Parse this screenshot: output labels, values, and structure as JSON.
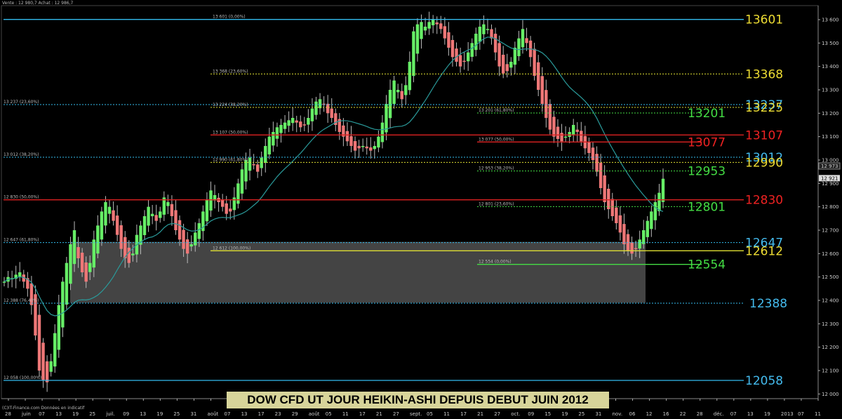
{
  "header": {
    "quote": "Vente : 12 980,7 Achat : 12 986,7"
  },
  "title": "DOW CFD UT JOUR HEIKIN-ASHI DEPUIS DEBUT JUIN 2012",
  "credit": "(C)IT-Finance.com Données en indicatif",
  "colors": {
    "background": "#000000",
    "up": "#66ee66",
    "down": "#ee7777",
    "ma": "#2a9a9a",
    "box": "#4b4b4b",
    "title_bg": "#d7d49a"
  },
  "chart_data": {
    "type": "candlestick",
    "ylim": [
      11980,
      13660
    ],
    "y_ticks": [
      12000,
      12100,
      12200,
      12300,
      12400,
      12500,
      12600,
      12700,
      12800,
      12900,
      13000,
      13100,
      13200,
      13300,
      13400,
      13500,
      13600
    ],
    "y_tick_labels": [
      "12 000",
      "12 100",
      "12 200",
      "12 300",
      "12 400",
      "12 500",
      "12 600",
      "12 700",
      "12 800",
      "12 900",
      "13 000",
      "13 100",
      "13 200",
      "13 300",
      "13 400",
      "13 500",
      "13 600"
    ],
    "last_price_label": "12 921",
    "last_price_tag": "12 973",
    "x_labels": [
      "28",
      "juin",
      "07",
      "13",
      "19",
      "25",
      "juil.",
      "09",
      "13",
      "19",
      "25",
      "31",
      "août",
      "07",
      "13",
      "17",
      "23",
      "29",
      "août",
      "05",
      "11",
      "17",
      "21",
      "27",
      "sept.",
      "05",
      "11",
      "17",
      "21",
      "27",
      "oct.",
      "09",
      "15",
      "19",
      "25",
      "31",
      "nov.",
      "06",
      "12",
      "16",
      "22",
      "28",
      "déc.",
      "07",
      "13",
      "19",
      "2013",
      "07",
      "11"
    ],
    "levels": [
      {
        "value": 13601,
        "label": "13601",
        "color": "#33bbee",
        "big_color": "#eedd33",
        "style": "solid",
        "small": "13 601 (0,00%)",
        "x_end": 1060
      },
      {
        "value": 13368,
        "label": "13368",
        "color": "#dddd33",
        "big_color": "#eedd33",
        "style": "dotted",
        "small": "13 368 (23,60%)",
        "x_end": 1060
      },
      {
        "value": 13237,
        "label": "13237",
        "color": "#33bbee",
        "big_color": "#44bbee",
        "style": "dotted",
        "small": "13 237 (23,60%)",
        "x_end": 1060
      },
      {
        "value": 13225,
        "label": "13225",
        "color": "#dddd33",
        "big_color": "#eedd33",
        "style": "dotted",
        "small": "13 224 (38,20%)",
        "x_end": 1060
      },
      {
        "value": 13201,
        "label": "13201",
        "color": "#44dd44",
        "big_color": "#44dd44",
        "style": "dotted",
        "small": "13 201 (61,80%)",
        "x_end": 1000
      },
      {
        "value": 13107,
        "label": "13107",
        "color": "#dd2222",
        "big_color": "#ee2222",
        "style": "solid",
        "small": "13 107 (50,00%)",
        "x_end": 1060
      },
      {
        "value": 13077,
        "label": "13077",
        "color": "#dd2222",
        "big_color": "#ee2222",
        "style": "solid",
        "small": "13 077 (50,00%)",
        "x_end": 1000
      },
      {
        "value": 13012,
        "label": "13012",
        "color": "#33bbee",
        "big_color": "#44bbee",
        "style": "dotted",
        "small": "13 012 (38,20%)",
        "x_end": 1060
      },
      {
        "value": 12990,
        "label": "12990",
        "color": "#dddd33",
        "big_color": "#eedd33",
        "style": "dotted",
        "small": "12 990 (61,80%)",
        "x_end": 1060
      },
      {
        "value": 12953,
        "label": "12953",
        "color": "#44dd44",
        "big_color": "#44dd44",
        "style": "dotted",
        "small": "12 953 (38,20%)",
        "x_end": 1000
      },
      {
        "value": 12830,
        "label": "12830",
        "color": "#dd2222",
        "big_color": "#ee2222",
        "style": "solid",
        "small": "12 830 (50,00%)",
        "x_end": 1060
      },
      {
        "value": 12801,
        "label": "12801",
        "color": "#44dd44",
        "big_color": "#44dd44",
        "style": "dotted",
        "small": "12 801 (23,60%)",
        "x_end": 1000
      },
      {
        "value": 12647,
        "label": "12647",
        "color": "#33bbee",
        "big_color": "#44bbee",
        "style": "dotted",
        "small": "12 647 (61,80%)",
        "x_end": 1060
      },
      {
        "value": 12612,
        "label": "12612",
        "color": "#dddd33",
        "big_color": "#eedd33",
        "style": "solid",
        "small": "12 612 (100,00%)",
        "x_end": 1060
      },
      {
        "value": 12554,
        "label": "12554",
        "color": "#44dd44",
        "big_color": "#44dd44",
        "style": "solid",
        "small": "12 554 (0,00%)",
        "x_end": 1000
      },
      {
        "value": 12388,
        "label": "12388",
        "color": "#33bbee",
        "big_color": "#44bbee",
        "style": "dotted",
        "small": "12 388 (76,40%)",
        "x_end": 1060
      },
      {
        "value": 12058,
        "label": "12058",
        "color": "#33bbee",
        "big_color": "#44bbee",
        "style": "solid",
        "small": "12 058 (100,00%)",
        "x_end": 1060
      }
    ],
    "range_box": {
      "top": 12650,
      "bottom": 12390
    },
    "closes": [
      12480,
      12500,
      12495,
      12510,
      12520,
      12480,
      12450,
      12380,
      12250,
      12100,
      12060,
      12050,
      12140,
      12260,
      12380,
      12480,
      12560,
      12640,
      12700,
      12580,
      12520,
      12480,
      12560,
      12660,
      12720,
      12780,
      12820,
      12800,
      12740,
      12680,
      12620,
      12580,
      12560,
      12600,
      12680,
      12720,
      12760,
      12800,
      12770,
      12740,
      12780,
      12840,
      12820,
      12760,
      12700,
      12660,
      12620,
      12600,
      12640,
      12690,
      12730,
      12780,
      12830,
      12870,
      12850,
      12820,
      12800,
      12770,
      12780,
      12840,
      12900,
      12960,
      13000,
      13010,
      12980,
      12950,
      13010,
      13060,
      13100,
      13120,
      13140,
      13150,
      13160,
      13170,
      13180,
      13160,
      13140,
      13150,
      13180,
      13220,
      13250,
      13260,
      13240,
      13200,
      13180,
      13150,
      13120,
      13100,
      13080,
      13060,
      13040,
      13050,
      13060,
      13050,
      13040,
      13060,
      13100,
      13160,
      13240,
      13300,
      13340,
      13300,
      13260,
      13320,
      13420,
      13550,
      13580,
      13590,
      13570,
      13590,
      13600,
      13580,
      13560,
      13520,
      13480,
      13440,
      13420,
      13400,
      13420,
      13460,
      13500,
      13540,
      13570,
      13580,
      13560,
      13520,
      13460,
      13400,
      13370,
      13380,
      13420,
      13480,
      13520,
      13560,
      13500,
      13440,
      13360,
      13300,
      13240,
      13180,
      13130,
      13100,
      13090,
      13080,
      13100,
      13120,
      13150,
      13120,
      13080,
      13050,
      13030,
      13000,
      12950,
      12880,
      12820,
      12790,
      12760,
      12730,
      12690,
      12640,
      12610,
      12600,
      12620,
      12660,
      12700,
      12740,
      12780,
      12820,
      12860,
      12920
    ]
  }
}
